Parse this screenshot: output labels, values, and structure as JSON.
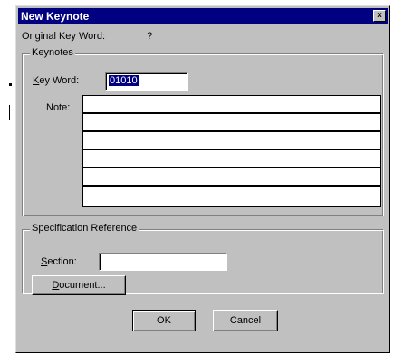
{
  "window": {
    "title": "New Keynote",
    "close_glyph": "×"
  },
  "original_key_word": {
    "label": "Original Key Word:",
    "value": "?"
  },
  "keynotes_group": {
    "legend": "Keynotes",
    "key_word_label_accel": "K",
    "key_word_label_rest": "ey Word:",
    "key_word_value": "01010",
    "note_label": "Note:",
    "note_rows": [
      "",
      "",
      "",
      "",
      "",
      ""
    ]
  },
  "spec_group": {
    "legend": "Specification Reference",
    "section_label_accel": "S",
    "section_label_rest": "ection:",
    "section_value": "",
    "document_button_accel": "D",
    "document_button_rest": "ocument..."
  },
  "buttons": {
    "ok": "OK",
    "cancel": "Cancel"
  }
}
